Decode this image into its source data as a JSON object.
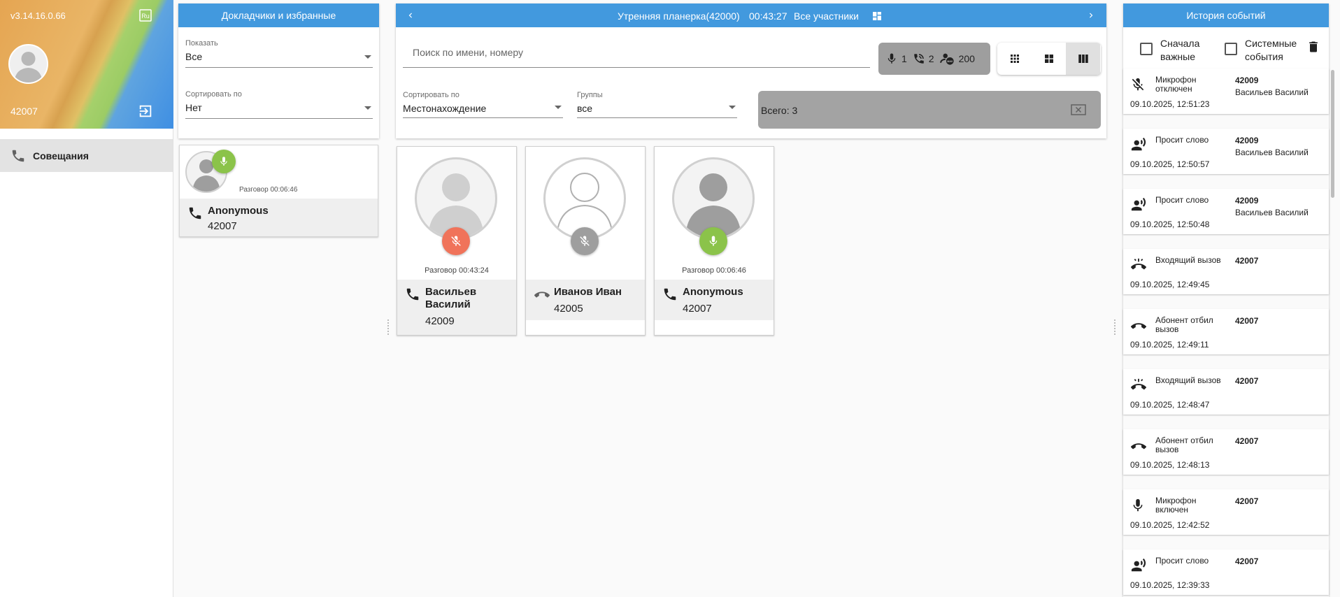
{
  "app": {
    "version": "v3.14.16.0.66",
    "lang_badge": "Ru",
    "user_number": "42007"
  },
  "nav": {
    "items": [
      {
        "label": "Совещания",
        "icon": "phone-icon"
      }
    ]
  },
  "favorites": {
    "title": "Докладчики и избранные",
    "show": {
      "label": "Показать",
      "value": "Все"
    },
    "sort": {
      "label": "Сортировать по",
      "value": "Нет"
    },
    "card": {
      "time": "Разговор 00:06:46",
      "name": "Anonymous",
      "number": "42007",
      "mic_state": "on"
    }
  },
  "conference": {
    "title": "Утренняя планерка(42000)",
    "duration": "00:43:27",
    "filter": "Все участники",
    "search_placeholder": "Поиск по имени, номеру",
    "counters": {
      "mic": "1",
      "calls": "2",
      "max": "200"
    },
    "sort": {
      "label": "Сортировать по",
      "value": "Местонахождение"
    },
    "groups": {
      "label": "Группы",
      "value": "все"
    },
    "total": "Всего: 3",
    "view_modes": [
      "grid-small",
      "grid-medium",
      "grid-large"
    ],
    "active_view": "grid-large",
    "participants": [
      {
        "name": "Васильев Василий",
        "number": "42009",
        "time": "Разговор 00:43:24",
        "mic_state": "muted",
        "connected": true
      },
      {
        "name": "Иванов Иван",
        "number": "42005",
        "time": "",
        "mic_state": "disabled",
        "connected": false
      },
      {
        "name": "Anonymous",
        "number": "42007",
        "time": "Разговор 00:06:46",
        "mic_state": "on",
        "connected": true
      }
    ]
  },
  "history": {
    "title": "История событий",
    "important_first": "Сначала важные",
    "system_events": "Системные события",
    "events": [
      {
        "icon": "mic-off-icon",
        "type": "Микрофон отключен",
        "time": "09.10.2025, 12:51:23",
        "number": "42009",
        "name": "Васильев Василий"
      },
      {
        "icon": "speak-request-icon",
        "type": "Просит слово",
        "time": "09.10.2025, 12:50:57",
        "number": "42009",
        "name": "Васильев Василий"
      },
      {
        "icon": "speak-request-icon",
        "type": "Просит слово",
        "time": "09.10.2025, 12:50:48",
        "number": "42009",
        "name": "Васильев Василий"
      },
      {
        "icon": "incoming-call-icon",
        "type": "Входящий вызов",
        "time": "09.10.2025, 12:49:45",
        "number": "42007",
        "name": ""
      },
      {
        "icon": "hangup-icon",
        "type": "Абонент отбил вызов",
        "time": "09.10.2025, 12:49:11",
        "number": "42007",
        "name": ""
      },
      {
        "icon": "incoming-call-icon",
        "type": "Входящий вызов",
        "time": "09.10.2025, 12:48:47",
        "number": "42007",
        "name": ""
      },
      {
        "icon": "hangup-icon",
        "type": "Абонент отбил вызов",
        "time": "09.10.2025, 12:48:13",
        "number": "42007",
        "name": ""
      },
      {
        "icon": "mic-icon",
        "type": "Микрофон включен",
        "time": "09.10.2025, 12:42:52",
        "number": "42007",
        "name": ""
      },
      {
        "icon": "speak-request-icon",
        "type": "Просит слово",
        "time": "09.10.2025, 12:39:33",
        "number": "42007",
        "name": ""
      }
    ]
  },
  "colors": {
    "header_blue": "#4299de",
    "mic_on": "#8bc34a",
    "mic_muted": "#f0735a",
    "mic_disabled": "#9e9e9e"
  }
}
